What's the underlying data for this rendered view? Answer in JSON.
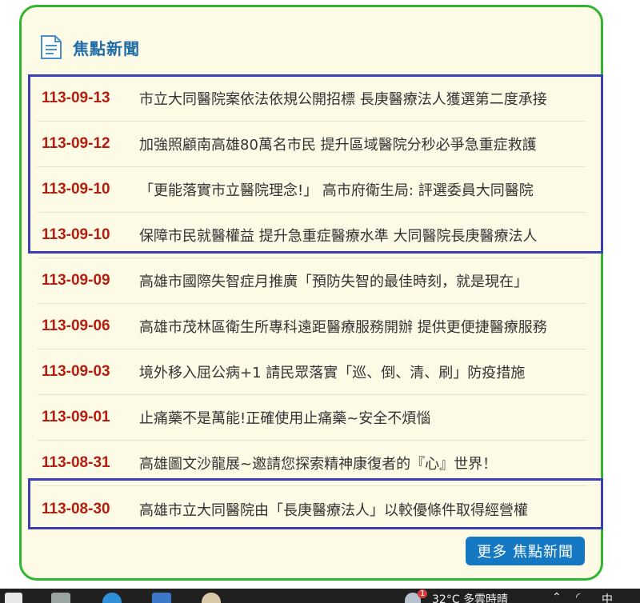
{
  "panel": {
    "title": "焦點新聞",
    "more_button_label": "更多 焦點新聞"
  },
  "news": [
    {
      "date": "113-09-13",
      "title": "市立大同醫院案依法依規公開招標 長庚醫療法人獲選第二度承接"
    },
    {
      "date": "113-09-12",
      "title": "加強照顧南高雄80萬名市民 提升區域醫院分秒必爭急重症救護"
    },
    {
      "date": "113-09-10",
      "title": "「更能落實市立醫院理念!」 高市府衛生局: 評選委員大同醫院"
    },
    {
      "date": "113-09-10",
      "title": "保障市民就醫權益 提升急重症醫療水準 大同醫院長庚醫療法人"
    },
    {
      "date": "113-09-09",
      "title": "高雄市國際失智症月推廣「預防失智的最佳時刻，就是現在」"
    },
    {
      "date": "113-09-06",
      "title": "高雄市茂林區衛生所專科遠距醫療服務開辦 提供更便捷醫療服務"
    },
    {
      "date": "113-09-03",
      "title": "境外移入屈公病+1 請民眾落實「巡、倒、清、刷」防疫措施"
    },
    {
      "date": "113-09-01",
      "title": "止痛藥不是萬能!正確使用止痛藥~安全不煩惱"
    },
    {
      "date": "113-08-31",
      "title": "高雄圖文沙龍展~邀請您探索精神康復者的『心』世界！"
    },
    {
      "date": "113-08-30",
      "title": "高雄市立大同醫院由「長庚醫療法人」以較優條件取得經營權"
    }
  ],
  "taskbar": {
    "weather": "32°C  多雲時晴",
    "notification_count": "1",
    "ime": "中"
  },
  "colors": {
    "panel_border": "#2fb52f",
    "panel_bg": "#fdfbe6",
    "title": "#1d6ca8",
    "date": "#b31e10",
    "highlight_box": "#3a3fb5",
    "button_bg": "#1479c2"
  },
  "icons": {
    "panel": "news-document-icon"
  }
}
